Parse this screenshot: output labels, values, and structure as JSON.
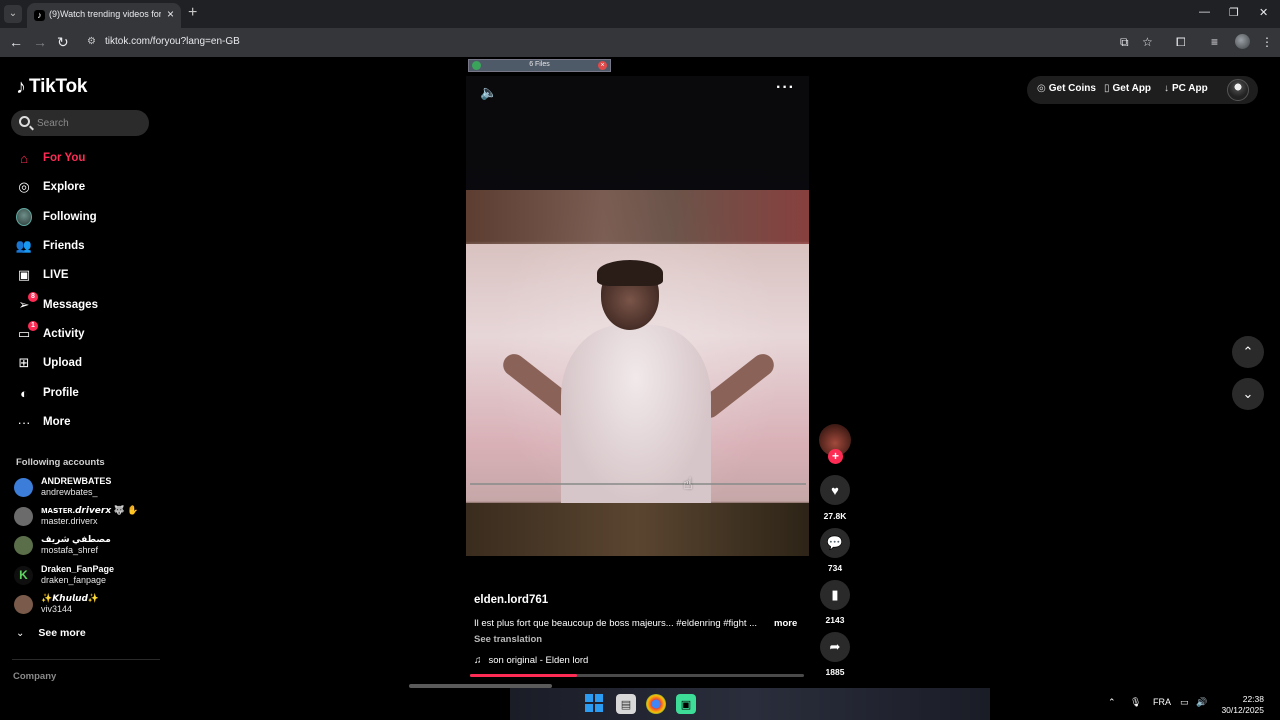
{
  "browser": {
    "tab_title": "(9)Watch trending videos for yo",
    "url": "tiktok.com/foryou?lang=en-GB"
  },
  "sidebar": {
    "logo": "TikTok",
    "search_placeholder": "Search",
    "nav": [
      {
        "label": "For You",
        "icon": "home-icon",
        "active": true
      },
      {
        "label": "Explore",
        "icon": "compass-icon"
      },
      {
        "label": "Following",
        "icon": "following-avatar"
      },
      {
        "label": "Friends",
        "icon": "friends-icon"
      },
      {
        "label": "LIVE",
        "icon": "live-icon"
      },
      {
        "label": "Messages",
        "icon": "messages-icon",
        "badge": "8"
      },
      {
        "label": "Activity",
        "icon": "activity-icon",
        "badge": "1"
      },
      {
        "label": "Upload",
        "icon": "upload-icon"
      },
      {
        "label": "Profile",
        "icon": "profile-icon"
      },
      {
        "label": "More",
        "icon": "more-dots-icon"
      }
    ],
    "following_title": "Following accounts",
    "accounts": [
      {
        "name": "ANDREWBATES",
        "handle": "andrewbates_",
        "color": "#3b7dd8"
      },
      {
        "name": "ᴍᴀꜱᴛᴇʀ.𝙙𝙧𝙞𝙫𝙚𝙧𝙭 🐺 ✋",
        "handle": "master.driverx",
        "color": "#6b6b6b"
      },
      {
        "name": "مصطفي شريف",
        "handle": "mostafa_shref",
        "color": "#5a6e4a"
      },
      {
        "name": "Draken_FanPage",
        "handle": "draken_fanpage",
        "color": "#0f0f0f"
      },
      {
        "name": "✨𝙆𝙝𝙪𝙡𝙪𝙙✨",
        "handle": "viv3144",
        "color": "#7a5a4a"
      }
    ],
    "see_more": "See more",
    "company": "Company"
  },
  "video": {
    "files_bar_label": "6 Files",
    "author": "elden.lord761",
    "caption": "Il est plus fort que beaucoup de boss majeurs... #eldenring #fight ...",
    "caption_more": "more",
    "see_translation": "See translation",
    "sound": "son original - Elden lord",
    "progress": 0.32
  },
  "actions": {
    "likes": "27.8K",
    "comments": "734",
    "saves": "2143",
    "shares": "1885"
  },
  "top_actions": {
    "get_coins": "Get Coins",
    "get_app": "Get App",
    "pc_app": "PC App"
  },
  "taskbar": {
    "lang": "FRA",
    "time": "22:38",
    "date": "30/12/2025"
  },
  "colors": {
    "accent": "#fe2c55",
    "background": "#000000"
  }
}
